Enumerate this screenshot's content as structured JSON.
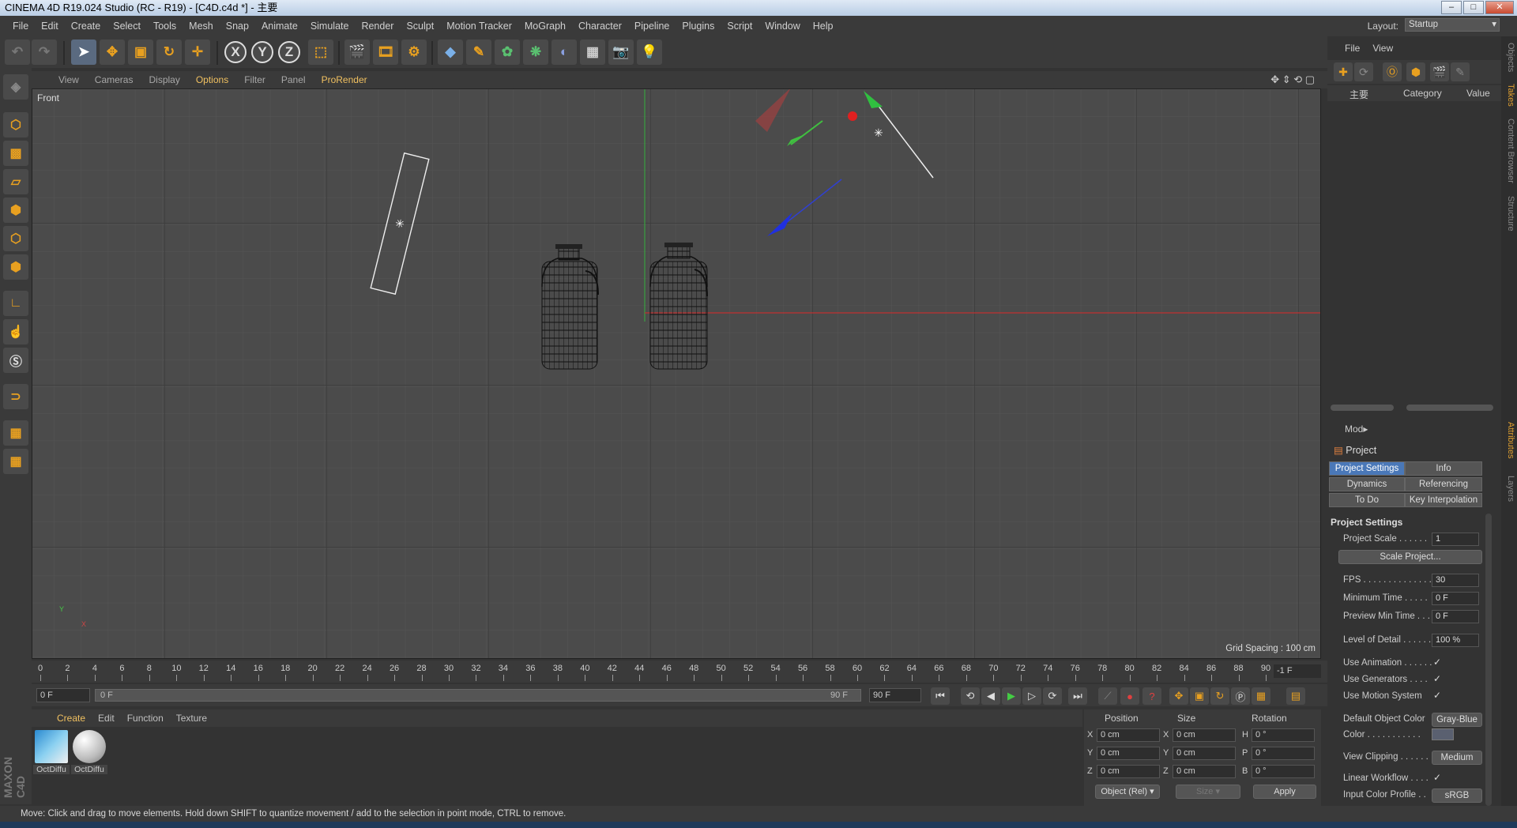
{
  "window": {
    "title": "CINEMA 4D R19.024 Studio (RC - R19) - [C4D.c4d *] - 主要",
    "minimize": "–",
    "maximize": "□",
    "close": "✕"
  },
  "menu": [
    "File",
    "Edit",
    "Create",
    "Select",
    "Tools",
    "Mesh",
    "Snap",
    "Animate",
    "Simulate",
    "Render",
    "Sculpt",
    "Motion Tracker",
    "MoGraph",
    "Character",
    "Pipeline",
    "Plugins",
    "Script",
    "Window",
    "Help"
  ],
  "layout": {
    "label": "Layout:",
    "value": "Startup"
  },
  "toolbar": {
    "axis_x": "X",
    "axis_y": "Y",
    "axis_z": "Z"
  },
  "viewport": {
    "menu": [
      "View",
      "Cameras",
      "Display",
      "Options",
      "Filter",
      "Panel",
      "ProRender"
    ],
    "active_menu": "Options",
    "name": "Front",
    "grid_spacing": "Grid Spacing : 100 cm",
    "axis_y": "Y",
    "axis_x": "X"
  },
  "timeline": {
    "ticks": [
      "0",
      "2",
      "4",
      "6",
      "8",
      "10",
      "12",
      "14",
      "16",
      "18",
      "20",
      "22",
      "24",
      "26",
      "28",
      "30",
      "32",
      "34",
      "36",
      "38",
      "40",
      "42",
      "44",
      "46",
      "48",
      "50",
      "52",
      "54",
      "56",
      "58",
      "60",
      "62",
      "64",
      "66",
      "68",
      "70",
      "72",
      "74",
      "76",
      "78",
      "80",
      "82",
      "84",
      "86",
      "88",
      "90"
    ],
    "current_frame": "-1 F"
  },
  "transport": {
    "start": "0 F",
    "slider_left": "0 F",
    "slider_right": "90 F",
    "end": "90 F"
  },
  "materials": {
    "menu": [
      "Create",
      "Edit",
      "Function",
      "Texture"
    ],
    "active_menu": "Create",
    "items": [
      {
        "label": "OctDiffu"
      },
      {
        "label": "OctDiffu"
      }
    ]
  },
  "coordinates": {
    "headers": [
      "Position",
      "Size",
      "Rotation"
    ],
    "rows": [
      {
        "pl": "X",
        "pv": "0 cm",
        "sl": "X",
        "sv": "0 cm",
        "rl": "H",
        "rv": "0 °"
      },
      {
        "pl": "Y",
        "pv": "0 cm",
        "sl": "Y",
        "sv": "0 cm",
        "rl": "P",
        "rv": "0 °"
      },
      {
        "pl": "Z",
        "pv": "0 cm",
        "sl": "Z",
        "sv": "0 cm",
        "rl": "B",
        "rv": "0 °"
      }
    ],
    "mode": "Object (Rel)",
    "size_mode": "Size",
    "apply": "Apply"
  },
  "objects_panel": {
    "menu": [
      "File",
      "View"
    ],
    "col_name": "主要",
    "col_category": "Category",
    "col_value": "Value"
  },
  "attributes": {
    "mode": "Mod",
    "project": "Project",
    "tabs": [
      "Project Settings",
      "Info",
      "Dynamics",
      "Referencing",
      "To Do",
      "Key Interpolation"
    ],
    "active_tab": "Project Settings",
    "section": "Project Settings",
    "project_scale_label": "Project Scale . . . . . .",
    "project_scale_value": "1",
    "scale_project_button": "Scale Project...",
    "fps_label": "FPS . . . . . . . . . . . . . .",
    "fps_value": "30",
    "min_time_label": "Minimum Time . . . . .",
    "min_time_value": "0 F",
    "preview_min_label": "Preview Min Time . . .",
    "preview_min_value": "0 F",
    "lod_label": "Level of Detail . . . . . .",
    "lod_value": "100 %",
    "use_animation": "Use Animation . . . . . .",
    "use_generators": "Use Generators . . . .",
    "use_motion": "Use Motion System",
    "check": "✓",
    "default_color_label": "Default Object Color",
    "default_color_value": "Gray-Blue",
    "color_label": "Color . . . . . . . . . . .",
    "view_clipping_label": "View Clipping . . . . . .",
    "view_clipping_value": "Medium",
    "linear_workflow": "Linear Workflow . . . .",
    "input_profile_label": "Input Color Profile . .",
    "input_profile_value": "sRGB"
  },
  "side_tabs": [
    "Objects",
    "Takes",
    "Content Browser",
    "Structure",
    "Attributes",
    "Layers"
  ],
  "status": "Move: Click and drag to move elements. Hold down SHIFT to quantize movement / add to the selection in point mode, CTRL to remove.",
  "colors": {
    "accent": "#e8a020",
    "tab_active": "#4a78b8",
    "viewport_bg": "#4b4b4b"
  }
}
